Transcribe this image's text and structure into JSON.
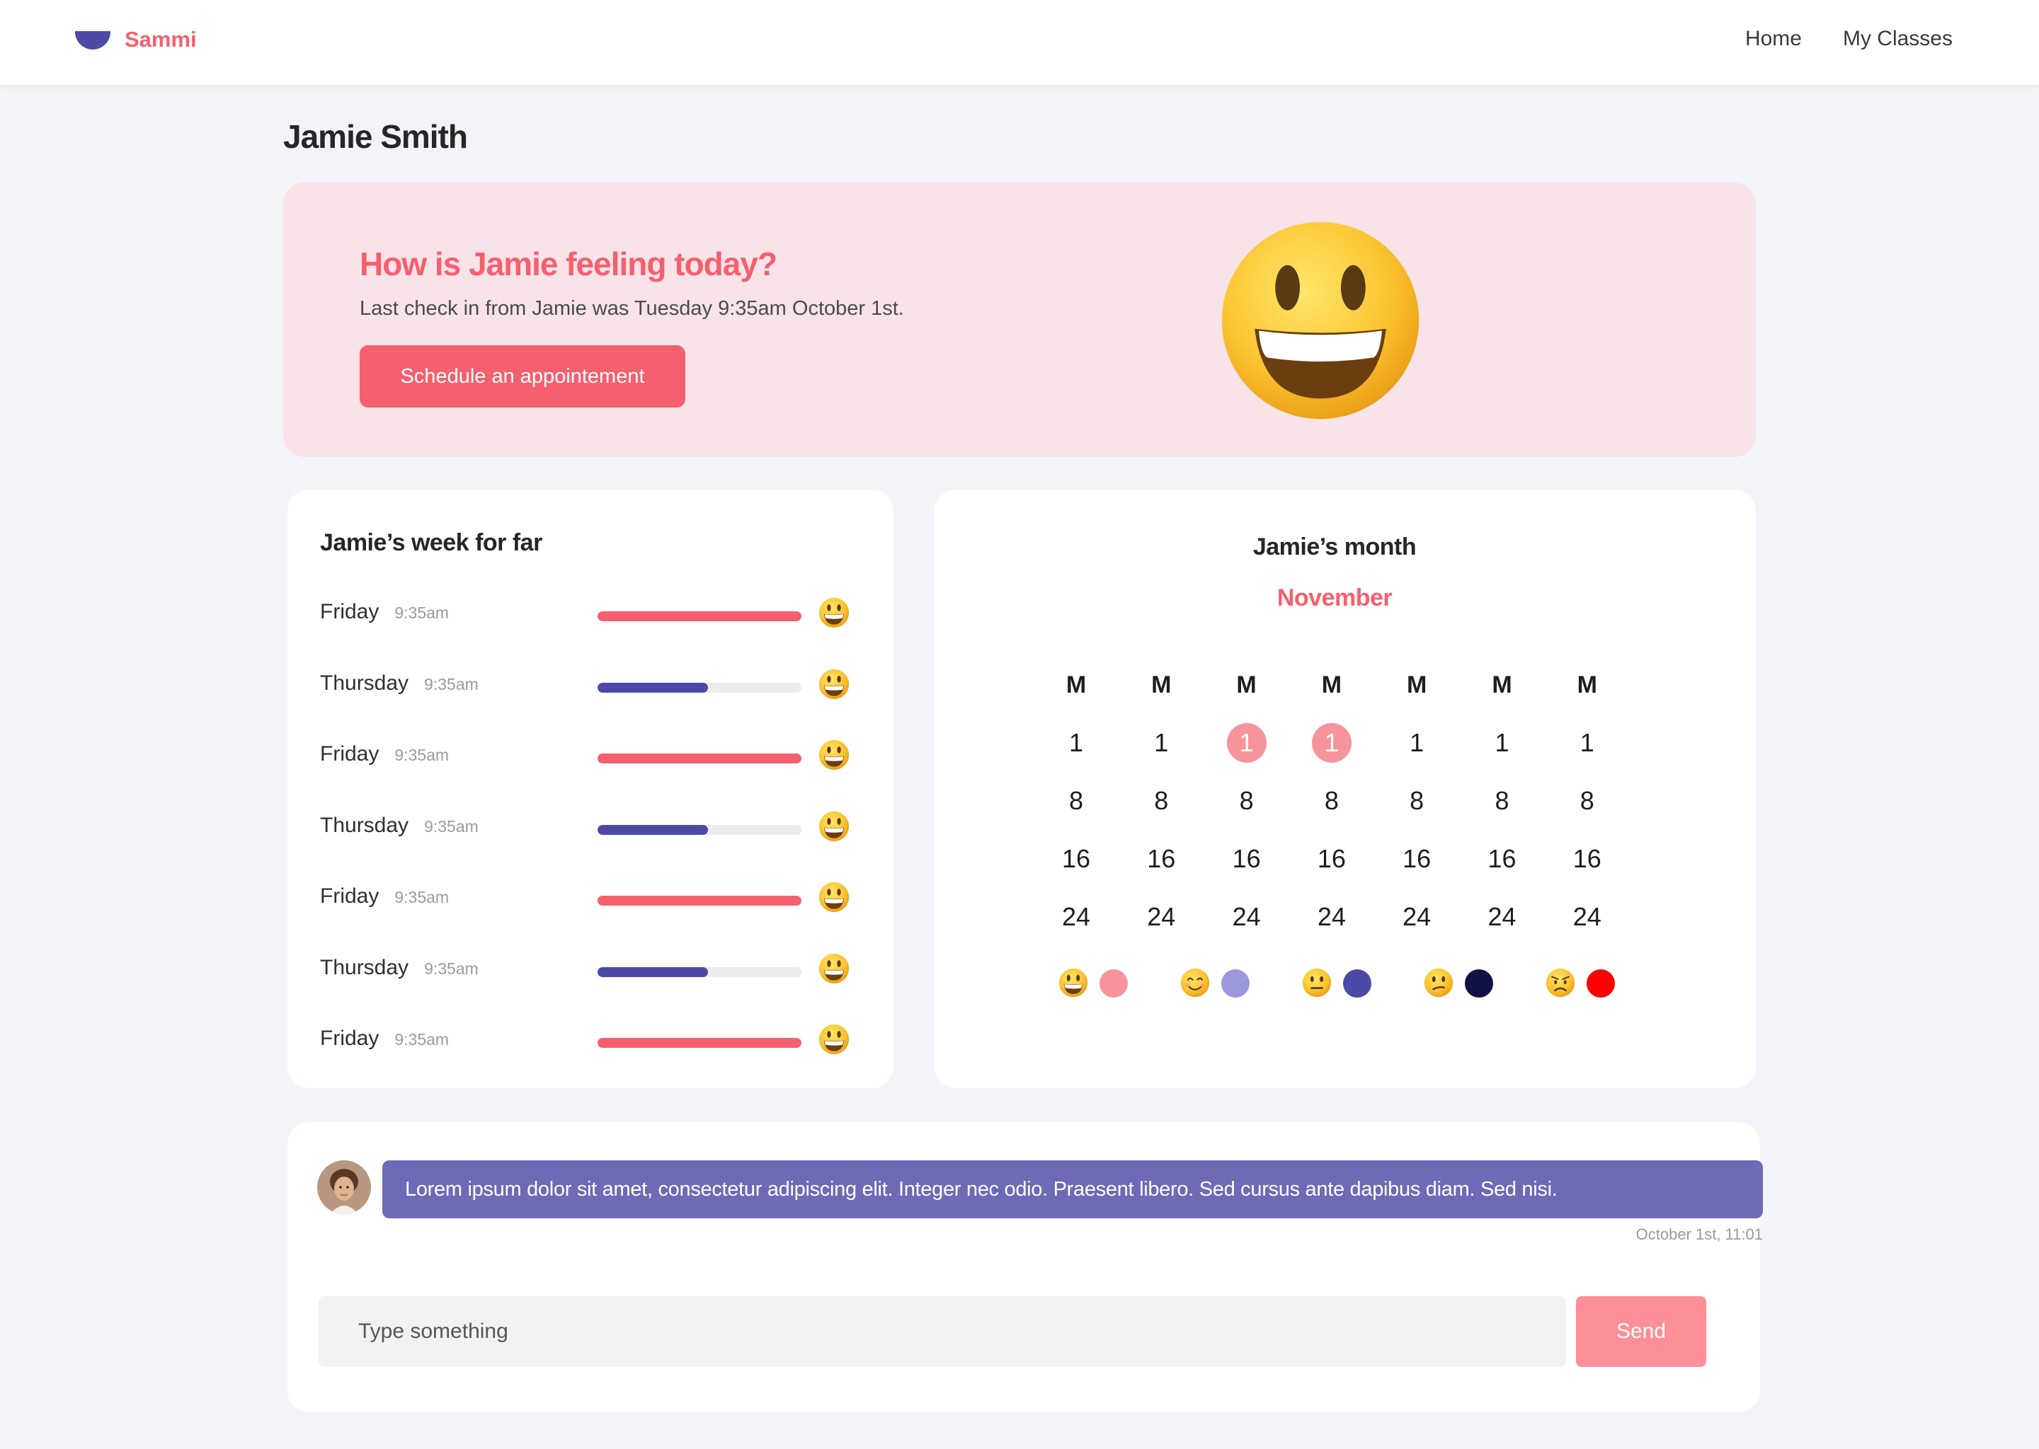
{
  "app": {
    "brand": "Sammi"
  },
  "nav": {
    "items": [
      "Home",
      "My Classes"
    ]
  },
  "student": {
    "name": "Jamie Smith"
  },
  "hero": {
    "title": "How is Jamie feeling today?",
    "subtitle": "Last check in from Jamie was Tuesday 9:35am October 1st.",
    "button_label": "Schedule an appointement",
    "mood_icon": "grinning-face-emoji"
  },
  "week": {
    "title": "Jamie’s week for far",
    "rows": [
      {
        "day": "Friday",
        "time": "9:35am",
        "level": 1.0,
        "color": "#f65f6e",
        "mood": "grinning-face-emoji"
      },
      {
        "day": "Thursday",
        "time": "9:35am",
        "level": 0.54,
        "color": "#4c4aa6",
        "mood": "grinning-face-emoji"
      },
      {
        "day": "Friday",
        "time": "9:35am",
        "level": 1.0,
        "color": "#f65f6e",
        "mood": "grinning-face-emoji"
      },
      {
        "day": "Thursday",
        "time": "9:35am",
        "level": 0.54,
        "color": "#4c4aa6",
        "mood": "grinning-face-emoji"
      },
      {
        "day": "Friday",
        "time": "9:35am",
        "level": 1.0,
        "color": "#f65f6e",
        "mood": "grinning-face-emoji"
      },
      {
        "day": "Thursday",
        "time": "9:35am",
        "level": 0.54,
        "color": "#4c4aa6",
        "mood": "grinning-face-emoji"
      },
      {
        "day": "Friday",
        "time": "9:35am",
        "level": 1.0,
        "color": "#f65f6e",
        "mood": "grinning-face-emoji"
      }
    ]
  },
  "month": {
    "title": "Jamie’s month",
    "name": "November",
    "weekday_headers": [
      "M",
      "M",
      "M",
      "M",
      "M",
      "M",
      "M"
    ],
    "weeks": [
      [
        "1",
        "1",
        "1",
        "1",
        "1",
        "1",
        "1"
      ],
      [
        "8",
        "8",
        "8",
        "8",
        "8",
        "8",
        "8"
      ],
      [
        "16",
        "16",
        "16",
        "16",
        "16",
        "16",
        "16"
      ],
      [
        "24",
        "24",
        "24",
        "24",
        "24",
        "24",
        "24"
      ]
    ],
    "highlighted": [
      [
        0,
        2
      ],
      [
        0,
        3
      ]
    ],
    "highlight_color": "#f6949c",
    "legend": [
      {
        "mood": "grinning-face-emoji",
        "color": "#f6949c"
      },
      {
        "mood": "smiling-face-emoji",
        "color": "#9b98dc"
      },
      {
        "mood": "neutral-face-emoji",
        "color": "#4c4aa6"
      },
      {
        "mood": "confused-face-emoji",
        "color": "#111146"
      },
      {
        "mood": "angry-face-emoji",
        "color": "#ff0000"
      }
    ]
  },
  "chat": {
    "message": "Lorem ipsum dolor sit amet, consectetur adipiscing elit. Integer nec odio. Praesent libero. Sed cursus ante dapibus diam. Sed nisi.",
    "timestamp": "October 1st, 11:01",
    "input_placeholder": "Type something",
    "send_label": "Send"
  },
  "colors": {
    "accent": "#f65f6e",
    "brand": "#4c4aa6",
    "bubble": "#6e6ab6",
    "background": "#f3f4f9"
  }
}
